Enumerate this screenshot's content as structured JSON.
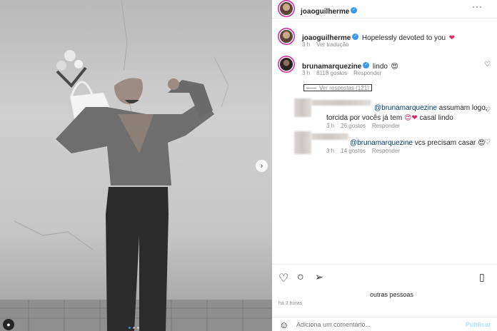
{
  "post": {
    "author": "joaoguilherme",
    "caption_author": "joaoguilherme",
    "caption": "Hopelessly devoted to you",
    "caption_emoji": "❤",
    "caption_time": "3 h",
    "translate_label": "Ver tradução",
    "time_ago": "há 3 horas",
    "likes_text": "outras pessoas"
  },
  "comments": [
    {
      "user": "brunamarquezine",
      "text": "lindo",
      "emoji": "😍",
      "time": "3 h",
      "likes": "8118 gostos",
      "reply_label": "Responder",
      "view_replies": "Ver respostas (121)"
    },
    {
      "mention": "@brunamarquezine",
      "text": " assumam logo,",
      "text2": "torcida por vocês já tem ",
      "emoji": "😍❤",
      "text3": " casal lindo",
      "time": "3 h",
      "likes": "26 gostos",
      "reply_label": "Responder"
    },
    {
      "mention": "@brunamarquezine",
      "text": " vcs precisam casar ",
      "emoji": "😍",
      "time": "3 h",
      "likes": "14 gostos",
      "reply_label": "Responder"
    }
  ],
  "composer": {
    "placeholder": "Adiciona um comentário...",
    "publish_label": "Publicar"
  },
  "icons": {
    "more": "more-options-icon",
    "heart": "heart-icon",
    "comment": "comment-icon",
    "share": "share-icon",
    "save": "bookmark-icon",
    "emoji": "emoji-icon",
    "next": "chevron-right-icon"
  },
  "colors": {
    "verified": "#3897f0",
    "story_ring": "#d6249f",
    "link": "#00376b",
    "carousel_active": "#3a8ee6"
  }
}
